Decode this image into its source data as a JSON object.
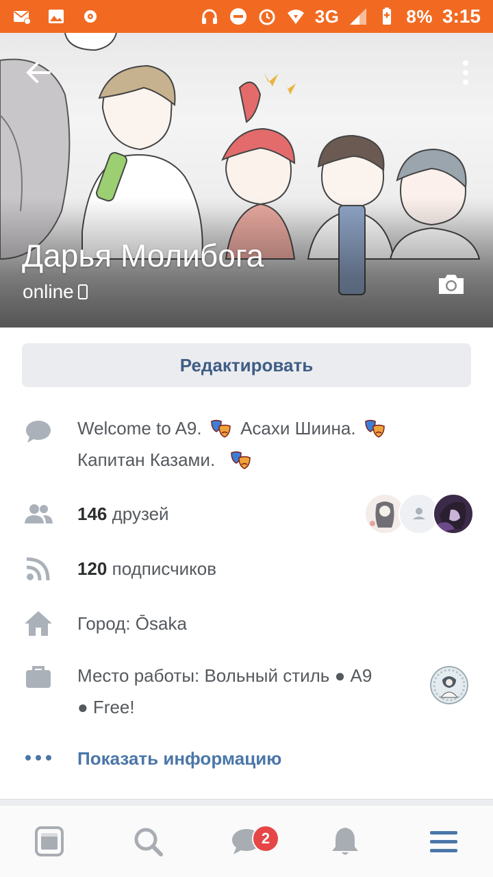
{
  "status_bar": {
    "network": "3G",
    "battery": "8%",
    "time": "3:15"
  },
  "profile": {
    "name": "Дарья Молибога",
    "status": "online",
    "edit_label": "Редактировать"
  },
  "info": {
    "status_text_line1": "Welcome to A9.",
    "status_text_mid": "Асахи Шиина.",
    "status_text_line2": "Капитан Казами.",
    "friends_count": "146",
    "friends_label": "друзей",
    "followers_count": "120",
    "followers_label": "подписчиков",
    "city": "Город: Ōsaka",
    "work_line1": "Место работы: Вольный стиль ● A9",
    "work_line2": "● Free!",
    "show_more": "Показать информацию"
  },
  "nav": {
    "messages_badge": "2"
  },
  "colors": {
    "status_bar": "#f26a22",
    "link": "#4a76a8",
    "button_text": "#3f5d85",
    "badge": "#e64646"
  }
}
